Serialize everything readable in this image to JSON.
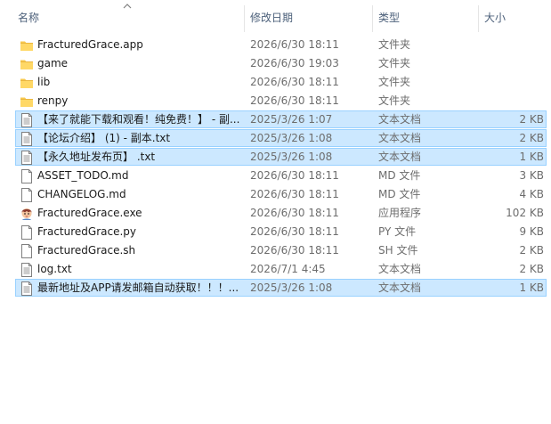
{
  "columns": {
    "name": "名称",
    "date": "修改日期",
    "type": "类型",
    "size": "大小"
  },
  "files": [
    {
      "name": "FracturedGrace.app",
      "date": "2026/6/30 18:11",
      "type": "文件夹",
      "size": "",
      "icon": "folder-icon",
      "selected": false
    },
    {
      "name": "game",
      "date": "2026/6/30 19:03",
      "type": "文件夹",
      "size": "",
      "icon": "folder-icon",
      "selected": false
    },
    {
      "name": "lib",
      "date": "2026/6/30 18:11",
      "type": "文件夹",
      "size": "",
      "icon": "folder-icon",
      "selected": false
    },
    {
      "name": "renpy",
      "date": "2026/6/30 18:11",
      "type": "文件夹",
      "size": "",
      "icon": "folder-icon",
      "selected": false
    },
    {
      "name": "【来了就能下载和观看！纯免费！】 - 副...",
      "date": "2025/3/26 1:07",
      "type": "文本文档",
      "size": "2 KB",
      "icon": "text-document-icon",
      "selected": true
    },
    {
      "name": "【论坛介绍】 (1) - 副本.txt",
      "date": "2025/3/26 1:08",
      "type": "文本文档",
      "size": "2 KB",
      "icon": "text-document-icon",
      "selected": true
    },
    {
      "name": "【永久地址发布页】 .txt",
      "date": "2025/3/26 1:08",
      "type": "文本文档",
      "size": "1 KB",
      "icon": "text-document-icon",
      "selected": true
    },
    {
      "name": "ASSET_TODO.md",
      "date": "2026/6/30 18:11",
      "type": "MD 文件",
      "size": "3 KB",
      "icon": "file-icon",
      "selected": false
    },
    {
      "name": "CHANGELOG.md",
      "date": "2026/6/30 18:11",
      "type": "MD 文件",
      "size": "4 KB",
      "icon": "file-icon",
      "selected": false
    },
    {
      "name": "FracturedGrace.exe",
      "date": "2026/6/30 18:11",
      "type": "应用程序",
      "size": "102 KB",
      "icon": "application-icon",
      "selected": false
    },
    {
      "name": "FracturedGrace.py",
      "date": "2026/6/30 18:11",
      "type": "PY 文件",
      "size": "9 KB",
      "icon": "file-icon",
      "selected": false
    },
    {
      "name": "FracturedGrace.sh",
      "date": "2026/6/30 18:11",
      "type": "SH 文件",
      "size": "2 KB",
      "icon": "file-icon",
      "selected": false
    },
    {
      "name": "log.txt",
      "date": "2026/7/1 4:45",
      "type": "文本文档",
      "size": "2 KB",
      "icon": "text-document-icon",
      "selected": false
    },
    {
      "name": "最新地址及APP请发邮箱自动获取！！！...",
      "date": "2025/3/26 1:08",
      "type": "文本文档",
      "size": "1 KB",
      "icon": "text-document-icon",
      "selected": true
    }
  ]
}
